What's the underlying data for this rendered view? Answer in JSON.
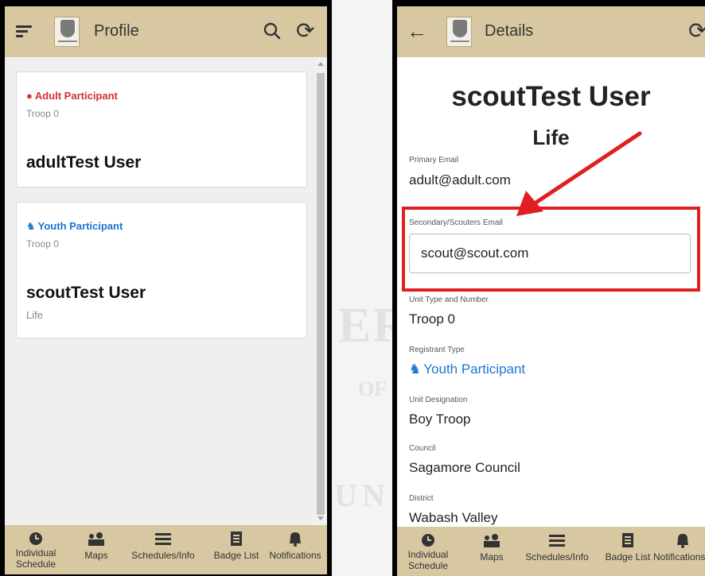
{
  "left": {
    "title": "Profile",
    "cards": [
      {
        "type": "Adult Participant",
        "unit": "Troop 0",
        "name": "adultTest User",
        "rank": ""
      },
      {
        "type": "Youth Participant",
        "unit": "Troop 0",
        "name": "scoutTest User",
        "rank": "Life"
      }
    ]
  },
  "right": {
    "title": "Details",
    "name": "scoutTest User",
    "rank": "Life",
    "fields": {
      "primary_email_label": "Primary Email",
      "primary_email": "adult@adult.com",
      "secondary_email_label": "Secondary/Scouters Email",
      "secondary_email": "scout@scout.com",
      "unit_label": "Unit Type and Number",
      "unit": "Troop 0",
      "registrant_label": "Registrant Type",
      "registrant": "Youth Participant",
      "designation_label": "Unit Designation",
      "designation": "Boy Troop",
      "council_label": "Council",
      "council": "Sagamore Council",
      "district_label": "District",
      "district": "Wabash Valley"
    }
  },
  "nav": {
    "individual": "Individual Schedule",
    "maps": "Maps",
    "schedules": "Schedules/Info",
    "badges": "Badge List",
    "notifications": "Notifications"
  },
  "colors": {
    "header": "#d8c8a2",
    "adult": "#d32f2f",
    "youth": "#1976d2",
    "highlight": "#e02020"
  },
  "icons": [
    "menu-icon",
    "back-icon",
    "search-icon",
    "refresh-icon",
    "clock-icon",
    "map-icon",
    "list-icon",
    "book-icon",
    "bell-icon",
    "person-icon",
    "hiker-icon"
  ]
}
